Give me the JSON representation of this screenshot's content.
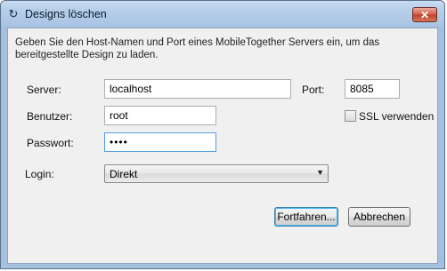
{
  "window": {
    "title": "Designs löschen",
    "icon": "refresh-icon",
    "close_glyph": "✕"
  },
  "intro_text": "Geben Sie den Host-Namen und Port eines MobileTogether Servers ein, um das bereitgestellte Design zu laden.",
  "form": {
    "server_label": "Server:",
    "server_value": "localhost",
    "port_label": "Port:",
    "port_value": "8085",
    "user_label": "Benutzer:",
    "user_value": "root",
    "ssl_label": "SSL verwenden",
    "ssl_checked": false,
    "password_label": "Passwort:",
    "password_value": "••••",
    "login_label": "Login:",
    "login_value": "Direkt"
  },
  "buttons": {
    "continue_label": "Fortfahren...",
    "cancel_label": "Abbrechen"
  }
}
